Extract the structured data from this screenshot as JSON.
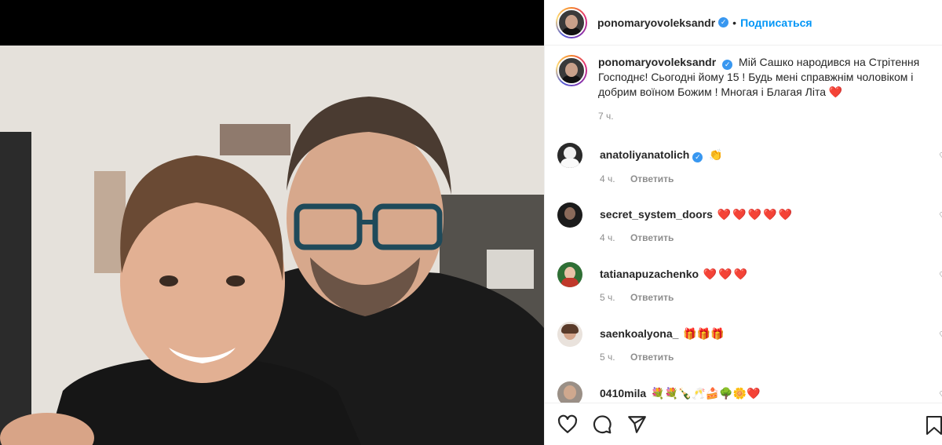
{
  "post": {
    "author": "ponomaryovoleksandr",
    "follow_label": "Подписаться",
    "caption": "Мій Сашко народився на Стрітення Господнє! Сьогодні йому 15 ! Будь мені справжнім чоловіком і добрим воїном Божим ! Многая і Благая Літа",
    "caption_emoji": "❤️",
    "caption_time": "7 ч."
  },
  "reply_label": "Ответить",
  "comments": [
    {
      "user": "anatoliyanatolich",
      "verified": true,
      "text": "👏",
      "time": "4 ч."
    },
    {
      "user": "secret_system_doors",
      "verified": false,
      "text": "❤️❤️❤️❤️❤️",
      "time": "4 ч."
    },
    {
      "user": "tatianapuzachenko",
      "verified": false,
      "text": "❤️❤️❤️",
      "time": "5 ч."
    },
    {
      "user": "saenkoalyona_",
      "verified": false,
      "text": "🎁🎁🎁",
      "time": "5 ч."
    },
    {
      "user": "0410mila",
      "verified": false,
      "text": "💐💐🍾🥂🍰🌳🌼❤️",
      "time": ""
    }
  ],
  "icons": {
    "like": "heart-icon",
    "comment": "comment-icon",
    "share": "share-icon",
    "save": "bookmark-icon"
  },
  "colors": {
    "link": "#0095f6",
    "muted": "#8e8e8e",
    "heart": "#ed1c24",
    "verified": "#3897f0"
  }
}
